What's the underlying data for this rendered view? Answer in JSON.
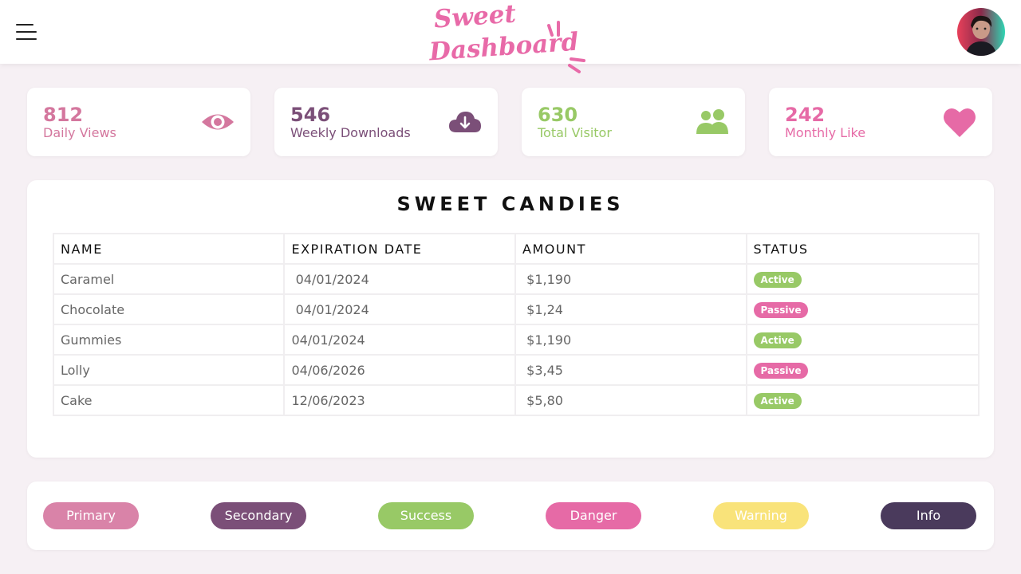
{
  "header": {
    "logo_line1": "Sweet",
    "logo_line2": "Dashboard",
    "menu_icon": "hamburger-menu-icon",
    "avatar_icon": "user-avatar"
  },
  "stats": [
    {
      "value": "812",
      "label": "Daily Views",
      "icon": "eye-icon",
      "color": "#d4779e"
    },
    {
      "value": "546",
      "label": "Weekly Downloads",
      "icon": "cloud-download-icon",
      "color": "#7b4f78"
    },
    {
      "value": "630",
      "label": "Total Visitor",
      "icon": "users-icon",
      "color": "#98c966"
    },
    {
      "value": "242",
      "label": "Monthly Like",
      "icon": "heart-icon",
      "color": "#e66aa6"
    }
  ],
  "table": {
    "title": "SWEET CANDIES",
    "headers": [
      "NAME",
      "EXPIRATION DATE",
      "AMOUNT",
      "STATUS"
    ],
    "rows": [
      {
        "name": "Caramel",
        "date": " 04/01/2024",
        "amount": " $1,190",
        "status": "Active"
      },
      {
        "name": "Chocolate",
        "date": " 04/01/2024",
        "amount": " $1,24",
        "status": "Passive"
      },
      {
        "name": "Gummies",
        "date": "04/01/2024",
        "amount": " $1,190",
        "status": "Active"
      },
      {
        "name": "Lolly",
        "date": "04/06/2026",
        "amount": " $3,45",
        "status": "Passive"
      },
      {
        "name": "Cake",
        "date": "12/06/2023",
        "amount": " $5,80",
        "status": "Active"
      }
    ]
  },
  "buttons": [
    {
      "label": "Primary",
      "color": "#d983a8"
    },
    {
      "label": "Secondary",
      "color": "#7b4f78"
    },
    {
      "label": "Success",
      "color": "#98c966"
    },
    {
      "label": "Danger",
      "color": "#e66aa6"
    },
    {
      "label": "Warning",
      "color": "#f9e37a"
    },
    {
      "label": "Info",
      "color": "#4a3a5c"
    }
  ],
  "colors": {
    "background": "#f6f0f4",
    "brand_pink": "#e86aa8",
    "active": "#98c966",
    "passive": "#e66aa6"
  }
}
